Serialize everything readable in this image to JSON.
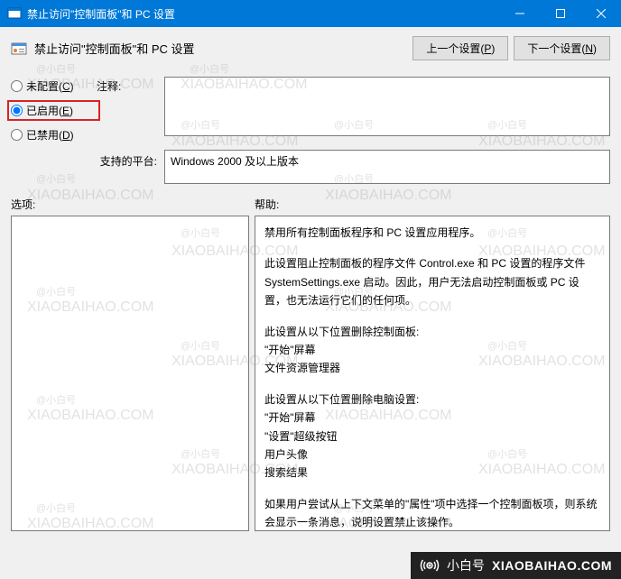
{
  "titlebar": {
    "title": "禁止访问\"控制面板\"和 PC 设置"
  },
  "header": {
    "title": "禁止访问\"控制面板\"和 PC 设置",
    "prev_btn": "上一个设置(P)",
    "next_btn": "下一个设置(N)"
  },
  "radios": {
    "not_configured": "未配置(C)",
    "enabled": "已启用(E)",
    "disabled": "已禁用(D)",
    "selected": "enabled"
  },
  "labels": {
    "comment": "注释:",
    "platform": "支持的平台:",
    "options": "选项:",
    "help": "帮助:"
  },
  "platform_text": "Windows 2000 及以上版本",
  "help_text": {
    "p1": "禁用所有控制面板程序和 PC 设置应用程序。",
    "p2": "此设置阻止控制面板的程序文件 Control.exe 和 PC 设置的程序文件 SystemSettings.exe 启动。因此，用户无法启动控制面板或 PC 设置，也无法运行它们的任何项。",
    "p3": "此设置从以下位置删除控制面板:",
    "p3a": "\"开始\"屏幕",
    "p3b": "文件资源管理器",
    "p4": "此设置从以下位置删除电脑设置:",
    "p4a": "\"开始\"屏幕",
    "p4b": "\"设置\"超级按钮",
    "p4c": "用户头像",
    "p4d": "搜索结果",
    "p5": "如果用户尝试从上下文菜单的\"属性\"项中选择一个控制面板项，则系统会显示一条消息，说明设置禁止该操作。"
  },
  "watermarks": {
    "cn": "@小白号",
    "url": "XIAOBAIHAO.COM"
  },
  "brand": {
    "cn": "小白号",
    "url": "XIAOBAIHAO.COM"
  }
}
